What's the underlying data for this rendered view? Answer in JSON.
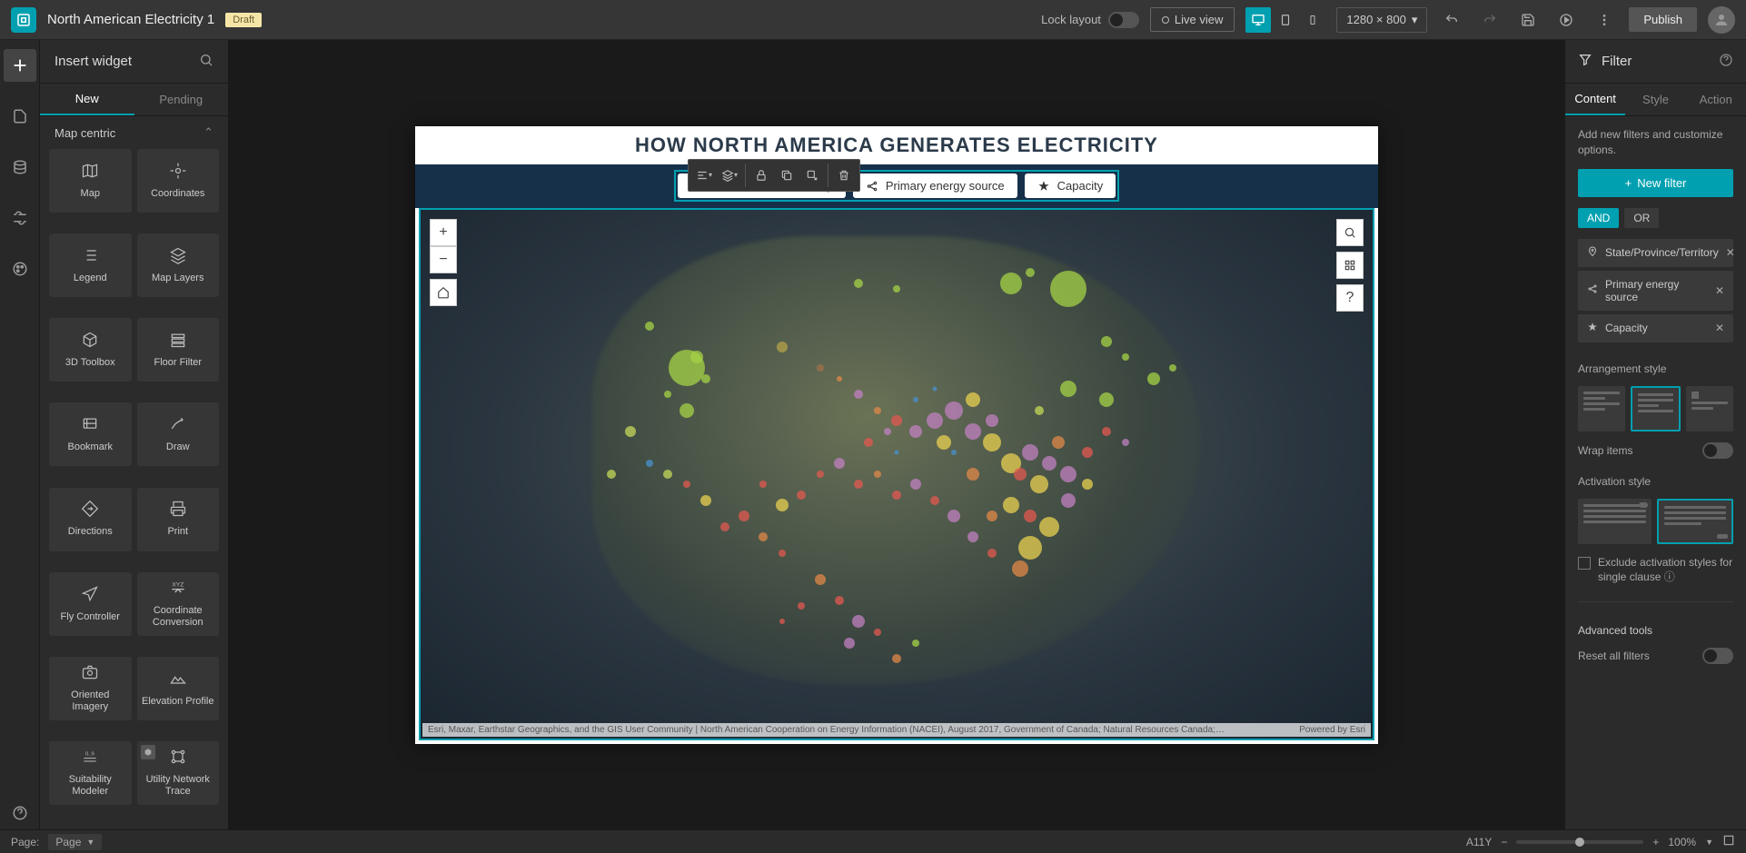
{
  "app": {
    "title": "North American Electricity 1",
    "badge": "Draft"
  },
  "topbar": {
    "lock_layout": "Lock layout",
    "live_view": "Live view",
    "resolution": "1280 × 800",
    "publish": "Publish"
  },
  "left_panel": {
    "title": "Insert widget",
    "tabs": {
      "new": "New",
      "pending": "Pending"
    },
    "section": "Map centric",
    "widgets": [
      {
        "label": "Map",
        "icon": "map"
      },
      {
        "label": "Coordinates",
        "icon": "target"
      },
      {
        "label": "Legend",
        "icon": "list"
      },
      {
        "label": "Map Layers",
        "icon": "layers"
      },
      {
        "label": "3D Toolbox",
        "icon": "cube"
      },
      {
        "label": "Floor Filter",
        "icon": "levels"
      },
      {
        "label": "Bookmark",
        "icon": "bookmark"
      },
      {
        "label": "Draw",
        "icon": "draw"
      },
      {
        "label": "Directions",
        "icon": "directions"
      },
      {
        "label": "Print",
        "icon": "print"
      },
      {
        "label": "Fly Controller",
        "icon": "plane"
      },
      {
        "label": "Coordinate Conversion",
        "icon": "xyz"
      },
      {
        "label": "Oriented Imagery",
        "icon": "camera"
      },
      {
        "label": "Elevation Profile",
        "icon": "elevation"
      },
      {
        "label": "Suitability Modeler",
        "icon": "suitability"
      },
      {
        "label": "Utility Network Trace",
        "icon": "network",
        "new": true
      }
    ]
  },
  "canvas": {
    "title": "HOW NORTH AMERICA GENERATES ELECTRICITY",
    "filters": [
      {
        "label": "State/Province/Territory",
        "icon": "pin"
      },
      {
        "label": "Primary energy source",
        "icon": "share"
      },
      {
        "label": "Capacity",
        "icon": "star"
      }
    ],
    "attribution": "Esri, Maxar, Earthstar Geographics, and the GIS User Community | North American Cooperation on Energy Information (NACEI), August 2017, Government of Canada; Natural Resources Canada; Strategic Policy a…",
    "powered": "Powered by Esri"
  },
  "right_panel": {
    "title": "Filter",
    "tabs": {
      "content": "Content",
      "style": "Style",
      "action": "Action"
    },
    "help": "Add new filters and customize options.",
    "new_filter": "New filter",
    "logic": {
      "and": "AND",
      "or": "OR"
    },
    "items": [
      {
        "label": "State/Province/Territory",
        "icon": "pin"
      },
      {
        "label": "Primary energy source",
        "icon": "share"
      },
      {
        "label": "Capacity",
        "icon": "star"
      }
    ],
    "arrangement_label": "Arrangement style",
    "wrap_label": "Wrap items",
    "activation_label": "Activation style",
    "exclude_label": "Exclude activation styles for single clause",
    "advanced_label": "Advanced tools",
    "reset_label": "Reset all filters"
  },
  "statusbar": {
    "page_label": "Page:",
    "page_value": "Page",
    "a11y": "A11Y",
    "zoom": "100%"
  },
  "chart_data": {
    "type": "map",
    "note": "Proportional-symbol map; symbol size encodes Capacity, color encodes Primary energy source. Exact values not readable from screenshot.",
    "points": [
      {
        "x": 28,
        "y": 30,
        "r": 40,
        "c": "#a4d146"
      },
      {
        "x": 29,
        "y": 28,
        "r": 14,
        "c": "#a4d146"
      },
      {
        "x": 30,
        "y": 32,
        "r": 10,
        "c": "#a4d146"
      },
      {
        "x": 28,
        "y": 38,
        "r": 16,
        "c": "#a4d146"
      },
      {
        "x": 26,
        "y": 35,
        "r": 8,
        "c": "#a4d146"
      },
      {
        "x": 24,
        "y": 22,
        "r": 10,
        "c": "#a4d146"
      },
      {
        "x": 22,
        "y": 42,
        "r": 12,
        "c": "#c5d85a"
      },
      {
        "x": 20,
        "y": 50,
        "r": 10,
        "c": "#c5d85a"
      },
      {
        "x": 46,
        "y": 14,
        "r": 10,
        "c": "#a4d146"
      },
      {
        "x": 50,
        "y": 15,
        "r": 8,
        "c": "#a4d146"
      },
      {
        "x": 62,
        "y": 14,
        "r": 24,
        "c": "#a4d146"
      },
      {
        "x": 64,
        "y": 12,
        "r": 10,
        "c": "#a4d146"
      },
      {
        "x": 68,
        "y": 15,
        "r": 40,
        "c": "#a4d146"
      },
      {
        "x": 72,
        "y": 25,
        "r": 12,
        "c": "#a4d146"
      },
      {
        "x": 74,
        "y": 28,
        "r": 8,
        "c": "#a4d146"
      },
      {
        "x": 77,
        "y": 32,
        "r": 14,
        "c": "#a4d146"
      },
      {
        "x": 79,
        "y": 30,
        "r": 8,
        "c": "#a4d146"
      },
      {
        "x": 72,
        "y": 36,
        "r": 16,
        "c": "#a4d146"
      },
      {
        "x": 68,
        "y": 34,
        "r": 18,
        "c": "#a4d146"
      },
      {
        "x": 65,
        "y": 38,
        "r": 10,
        "c": "#c5d85a"
      },
      {
        "x": 38,
        "y": 26,
        "r": 12,
        "c": "#b5a24a"
      },
      {
        "x": 42,
        "y": 30,
        "r": 8,
        "c": "#a07048"
      },
      {
        "x": 44,
        "y": 32,
        "r": 6,
        "c": "#e08848"
      },
      {
        "x": 46,
        "y": 35,
        "r": 10,
        "c": "#c080c0"
      },
      {
        "x": 48,
        "y": 38,
        "r": 8,
        "c": "#e08848"
      },
      {
        "x": 50,
        "y": 40,
        "r": 12,
        "c": "#e35850"
      },
      {
        "x": 52,
        "y": 42,
        "r": 14,
        "c": "#c080c0"
      },
      {
        "x": 54,
        "y": 40,
        "r": 18,
        "c": "#c080c0"
      },
      {
        "x": 56,
        "y": 38,
        "r": 20,
        "c": "#c080c0"
      },
      {
        "x": 55,
        "y": 44,
        "r": 16,
        "c": "#e8d050"
      },
      {
        "x": 58,
        "y": 42,
        "r": 18,
        "c": "#c080c0"
      },
      {
        "x": 60,
        "y": 44,
        "r": 20,
        "c": "#e8d050"
      },
      {
        "x": 60,
        "y": 40,
        "r": 14,
        "c": "#c080c0"
      },
      {
        "x": 58,
        "y": 36,
        "r": 16,
        "c": "#e8d050"
      },
      {
        "x": 62,
        "y": 48,
        "r": 22,
        "c": "#e8d050"
      },
      {
        "x": 64,
        "y": 46,
        "r": 18,
        "c": "#c080c0"
      },
      {
        "x": 63,
        "y": 50,
        "r": 14,
        "c": "#e35850"
      },
      {
        "x": 66,
        "y": 48,
        "r": 16,
        "c": "#c080c0"
      },
      {
        "x": 65,
        "y": 52,
        "r": 20,
        "c": "#e8d050"
      },
      {
        "x": 68,
        "y": 50,
        "r": 18,
        "c": "#c080c0"
      },
      {
        "x": 67,
        "y": 44,
        "r": 14,
        "c": "#e08848"
      },
      {
        "x": 70,
        "y": 46,
        "r": 12,
        "c": "#e35850"
      },
      {
        "x": 68,
        "y": 55,
        "r": 16,
        "c": "#c080c0"
      },
      {
        "x": 62,
        "y": 56,
        "r": 18,
        "c": "#e8d050"
      },
      {
        "x": 64,
        "y": 58,
        "r": 14,
        "c": "#e35850"
      },
      {
        "x": 60,
        "y": 58,
        "r": 12,
        "c": "#e08848"
      },
      {
        "x": 66,
        "y": 60,
        "r": 22,
        "c": "#e8d050"
      },
      {
        "x": 64,
        "y": 64,
        "r": 26,
        "c": "#e8d050"
      },
      {
        "x": 63,
        "y": 68,
        "r": 18,
        "c": "#e08848"
      },
      {
        "x": 60,
        "y": 65,
        "r": 10,
        "c": "#e35850"
      },
      {
        "x": 58,
        "y": 62,
        "r": 12,
        "c": "#c080c0"
      },
      {
        "x": 56,
        "y": 58,
        "r": 14,
        "c": "#c080c0"
      },
      {
        "x": 54,
        "y": 55,
        "r": 10,
        "c": "#e35850"
      },
      {
        "x": 52,
        "y": 52,
        "r": 12,
        "c": "#c080c0"
      },
      {
        "x": 50,
        "y": 54,
        "r": 10,
        "c": "#e35850"
      },
      {
        "x": 48,
        "y": 50,
        "r": 8,
        "c": "#e08848"
      },
      {
        "x": 46,
        "y": 52,
        "r": 10,
        "c": "#e35850"
      },
      {
        "x": 44,
        "y": 48,
        "r": 12,
        "c": "#c080c0"
      },
      {
        "x": 42,
        "y": 50,
        "r": 8,
        "c": "#e35850"
      },
      {
        "x": 40,
        "y": 54,
        "r": 10,
        "c": "#e35850"
      },
      {
        "x": 38,
        "y": 56,
        "r": 14,
        "c": "#e8d050"
      },
      {
        "x": 36,
        "y": 52,
        "r": 8,
        "c": "#e35850"
      },
      {
        "x": 34,
        "y": 58,
        "r": 12,
        "c": "#e35850"
      },
      {
        "x": 36,
        "y": 62,
        "r": 10,
        "c": "#e08848"
      },
      {
        "x": 38,
        "y": 65,
        "r": 8,
        "c": "#e35850"
      },
      {
        "x": 32,
        "y": 60,
        "r": 10,
        "c": "#e35850"
      },
      {
        "x": 30,
        "y": 55,
        "r": 12,
        "c": "#e8d050"
      },
      {
        "x": 28,
        "y": 52,
        "r": 8,
        "c": "#e35850"
      },
      {
        "x": 26,
        "y": 50,
        "r": 10,
        "c": "#c5d85a"
      },
      {
        "x": 24,
        "y": 48,
        "r": 8,
        "c": "#4a90d0"
      },
      {
        "x": 52,
        "y": 36,
        "r": 6,
        "c": "#4a90d0"
      },
      {
        "x": 54,
        "y": 34,
        "r": 5,
        "c": "#4a90d0"
      },
      {
        "x": 56,
        "y": 46,
        "r": 6,
        "c": "#4a90d0"
      },
      {
        "x": 50,
        "y": 46,
        "r": 5,
        "c": "#4a90d0"
      },
      {
        "x": 42,
        "y": 70,
        "r": 12,
        "c": "#e08848"
      },
      {
        "x": 44,
        "y": 74,
        "r": 10,
        "c": "#e35850"
      },
      {
        "x": 46,
        "y": 78,
        "r": 14,
        "c": "#c080c0"
      },
      {
        "x": 45,
        "y": 82,
        "r": 12,
        "c": "#c080c0"
      },
      {
        "x": 48,
        "y": 80,
        "r": 8,
        "c": "#e35850"
      },
      {
        "x": 50,
        "y": 85,
        "r": 10,
        "c": "#e08848"
      },
      {
        "x": 52,
        "y": 82,
        "r": 8,
        "c": "#a4d146"
      },
      {
        "x": 40,
        "y": 75,
        "r": 8,
        "c": "#e35850"
      },
      {
        "x": 38,
        "y": 78,
        "r": 6,
        "c": "#e35850"
      },
      {
        "x": 72,
        "y": 42,
        "r": 10,
        "c": "#e35850"
      },
      {
        "x": 74,
        "y": 44,
        "r": 8,
        "c": "#c080c0"
      },
      {
        "x": 70,
        "y": 52,
        "r": 12,
        "c": "#e8d050"
      },
      {
        "x": 58,
        "y": 50,
        "r": 14,
        "c": "#e08848"
      },
      {
        "x": 47,
        "y": 44,
        "r": 10,
        "c": "#e35850"
      },
      {
        "x": 49,
        "y": 42,
        "r": 8,
        "c": "#c080c0"
      }
    ]
  }
}
